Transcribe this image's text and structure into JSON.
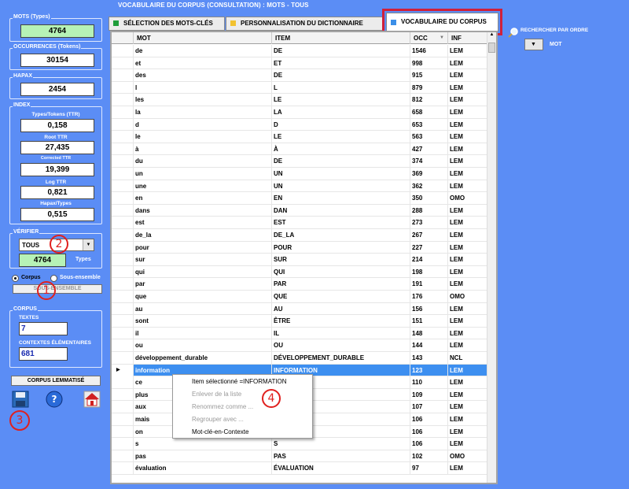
{
  "window_title": "VOCABULAIRE DU CORPUS (CONSULTATION) : MOTS - TOUS",
  "tabs": [
    {
      "label": "SÉLECTION DES MOTS-CLÉS",
      "color": "#1f9d3b"
    },
    {
      "label": "PERSONNALISATION DU DICTIONNAIRE",
      "color": "#f2c230"
    },
    {
      "label": "VOCABULAIRE DU CORPUS",
      "color": "#3b8fe8"
    }
  ],
  "search": {
    "label": "RECHERCHER PAR ORDRE",
    "order_value": "MOT"
  },
  "stats": {
    "mots_label": "MOTS (Types)",
    "mots_value": "4764",
    "occ_label": "OCCURRENCES (Tokens)",
    "occ_value": "30154",
    "hapax_label": "HAPAX",
    "hapax_value": "2454",
    "index_label": "INDEX",
    "ttr_label": "Types/Tokens (TTR)",
    "ttr_value": "0,158",
    "root_label": "Root TTR",
    "root_value": "27,435",
    "corrected_label": "Corrected TTR",
    "corrected_value": "19,399",
    "log_label": "Log TTR",
    "log_value": "0,821",
    "hapax_types_label": "Hapax/Types",
    "hapax_types_value": "0,515"
  },
  "verifier": {
    "label": "VÉRIFIER",
    "select_value": "TOUS",
    "count": "4764",
    "unit": "Types"
  },
  "scope": {
    "corpus_label": "Corpus",
    "subset_label": "Sous-ensemble",
    "subset_button": "SOUS-ENSEMBLE"
  },
  "corpus": {
    "label": "CORPUS",
    "textes_label": "TEXTES",
    "textes_value": "7",
    "contextes_label": "CONTEXTES ÉLÉMENTAIRES",
    "contextes_value": "681"
  },
  "lemmatise_button": "CORPUS LEMMATISÉ",
  "annotations": [
    "1",
    "2",
    "3",
    "4"
  ],
  "table": {
    "headers": [
      "MOT",
      "ITEM",
      "OCC",
      "INF"
    ],
    "rows": [
      [
        "de",
        "DE",
        "1546",
        "LEM"
      ],
      [
        "et",
        "ET",
        "998",
        "LEM"
      ],
      [
        "des",
        "DE",
        "915",
        "LEM"
      ],
      [
        "l",
        "L",
        "879",
        "LEM"
      ],
      [
        "les",
        "LE",
        "812",
        "LEM"
      ],
      [
        "la",
        "LA",
        "658",
        "LEM"
      ],
      [
        "d",
        "D",
        "653",
        "LEM"
      ],
      [
        "le",
        "LE",
        "563",
        "LEM"
      ],
      [
        "à",
        "À",
        "427",
        "LEM"
      ],
      [
        "du",
        "DE",
        "374",
        "LEM"
      ],
      [
        "un",
        "UN",
        "369",
        "LEM"
      ],
      [
        "une",
        "UN",
        "362",
        "LEM"
      ],
      [
        "en",
        "EN",
        "350",
        "OMO"
      ],
      [
        "dans",
        "DAN",
        "288",
        "LEM"
      ],
      [
        "est",
        "EST",
        "273",
        "LEM"
      ],
      [
        "de_la",
        "DE_LA",
        "267",
        "LEM"
      ],
      [
        "pour",
        "POUR",
        "227",
        "LEM"
      ],
      [
        "sur",
        "SUR",
        "214",
        "LEM"
      ],
      [
        "qui",
        "QUI",
        "198",
        "LEM"
      ],
      [
        "par",
        "PAR",
        "191",
        "LEM"
      ],
      [
        "que",
        "QUE",
        "176",
        "OMO"
      ],
      [
        "au",
        "AU",
        "156",
        "LEM"
      ],
      [
        "sont",
        "ÊTRE",
        "151",
        "LEM"
      ],
      [
        "il",
        "IL",
        "148",
        "LEM"
      ],
      [
        "ou",
        "OU",
        "144",
        "LEM"
      ],
      [
        "développement_durable",
        "DÉVELOPPEMENT_DURABLE",
        "143",
        "NCL"
      ],
      [
        "information",
        "INFORMATION",
        "123",
        "LEM"
      ],
      [
        "ce",
        "",
        "110",
        "LEM"
      ],
      [
        "plus",
        "",
        "109",
        "LEM"
      ],
      [
        "aux",
        "",
        "107",
        "LEM"
      ],
      [
        "mais",
        "",
        "106",
        "LEM"
      ],
      [
        "on",
        "",
        "106",
        "LEM"
      ],
      [
        "s",
        "S",
        "106",
        "LEM"
      ],
      [
        "pas",
        "PAS",
        "102",
        "OMO"
      ],
      [
        "évaluation",
        "ÉVALUATION",
        "97",
        "LEM"
      ]
    ]
  },
  "context_menu": {
    "items": [
      {
        "label": "Item sélectionné =INFORMATION",
        "disabled": false
      },
      {
        "label": "Enlever de la liste",
        "disabled": true
      },
      {
        "label": "Renommez comme ...",
        "disabled": true
      },
      {
        "label": "Regrouper avec ...",
        "disabled": true
      },
      {
        "label": "Mot-clé-en-Contexte",
        "disabled": false
      }
    ]
  }
}
